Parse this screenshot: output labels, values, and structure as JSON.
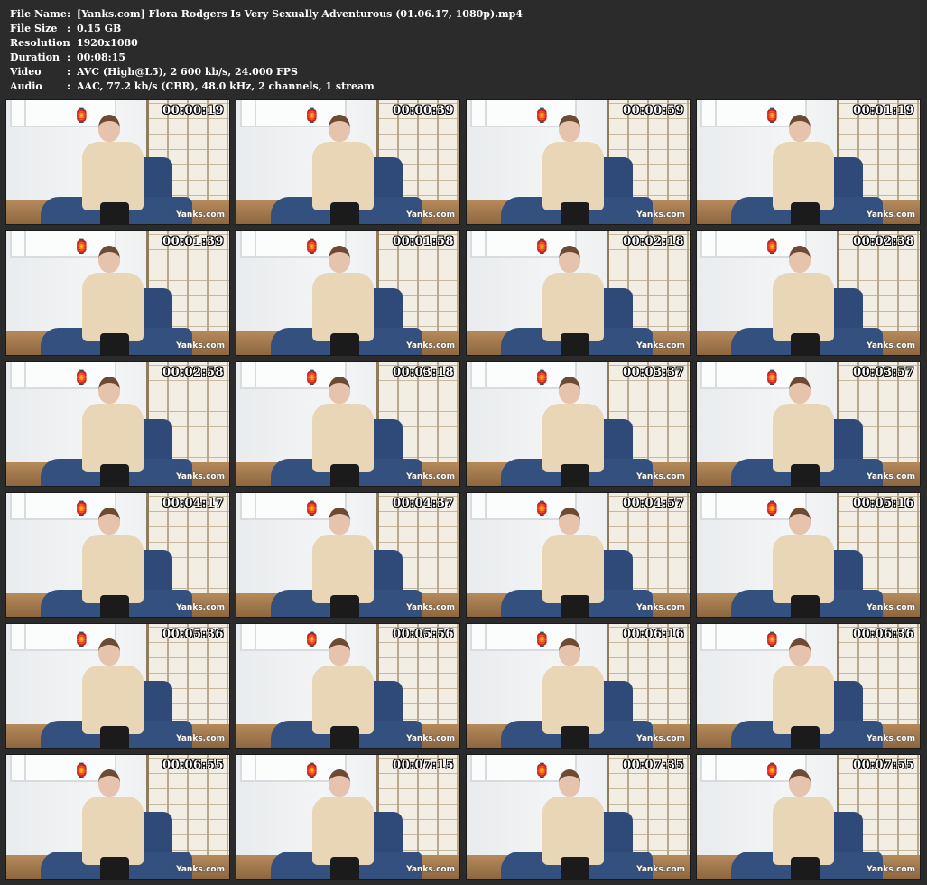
{
  "info": [
    {
      "key": "File Name",
      "value": "[Yanks.com] Flora Rodgers Is Very Sexually Adventurous (01.06.17, 1080p).mp4"
    },
    {
      "key": "File Size",
      "value": "0.15 GB"
    },
    {
      "key": "Resolution",
      "value": "1920x1080"
    },
    {
      "key": "Duration",
      "value": "00:08:15"
    },
    {
      "key": "Video",
      "value": "AVC (High@L5), 2 600 kb/s, 24.000 FPS"
    },
    {
      "key": "Audio",
      "value": "AAC, 77.2 kb/s (CBR), 48.0 kHz, 2 channels, 1 stream"
    }
  ],
  "separator": ":",
  "watermark": "Yanks.com",
  "timestamps": [
    "00:00:19",
    "00:00:39",
    "00:00:59",
    "00:01:19",
    "00:01:39",
    "00:01:58",
    "00:02:18",
    "00:02:38",
    "00:02:58",
    "00:03:18",
    "00:03:37",
    "00:03:57",
    "00:04:17",
    "00:04:37",
    "00:04:57",
    "00:05:16",
    "00:05:36",
    "00:05:56",
    "00:06:16",
    "00:06:36",
    "00:06:55",
    "00:07:15",
    "00:07:35",
    "00:07:55"
  ],
  "icons": {
    "lantern": "lantern-icon"
  }
}
